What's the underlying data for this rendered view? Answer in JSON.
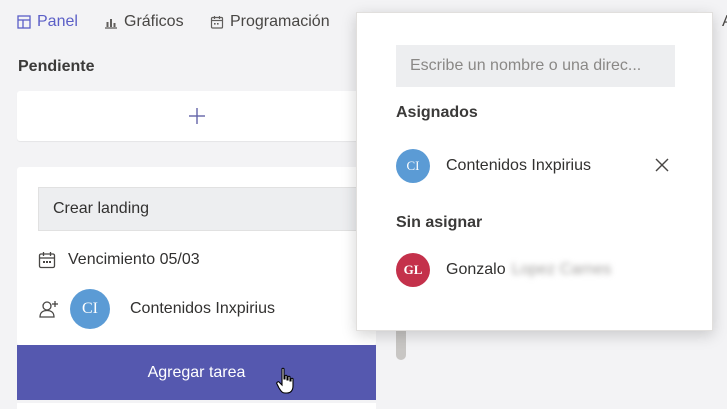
{
  "tabs": [
    {
      "label": "Panel",
      "icon": "board-icon",
      "active": true
    },
    {
      "label": "Gráficos",
      "icon": "chart-icon",
      "active": false
    },
    {
      "label": "Programación",
      "icon": "calendar-icon",
      "active": false
    },
    {
      "label": "A",
      "icon": "",
      "active": false
    }
  ],
  "bucket": {
    "title": "Pendiente",
    "add_icon": "plus-icon"
  },
  "task": {
    "name": "Crear landing",
    "due_label": "Vencimiento 05/03",
    "assignee_initials": "CI",
    "assignee_name": "Contenidos Inxpirius",
    "assignee_color": "#5b9bd5"
  },
  "add_task_button": "Agregar tarea",
  "assign_popup": {
    "search_placeholder": "Escribe un nombre o una direc...",
    "assigned_label": "Asignados",
    "assigned": [
      {
        "initials": "CI",
        "name": "Contenidos Inxpirius",
        "color": "#5b9bd5"
      }
    ],
    "unassigned_label": "Sin asignar",
    "unassigned": [
      {
        "initials": "GL",
        "name": "Gonzalo",
        "name_blurred": "Lopez Carnes",
        "color": "#c4314b"
      }
    ]
  },
  "colors": {
    "accent": "#5558af",
    "active_tab": "#5b5fc7"
  }
}
